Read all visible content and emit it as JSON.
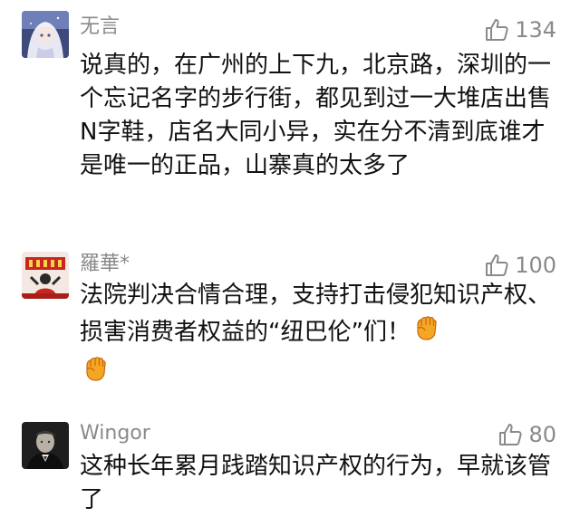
{
  "comments": [
    {
      "user": "无言",
      "likes": "134",
      "text": "说真的，在广州的上下九，北京路，深圳的一个忘记名字的步行街，都见到过一大堆店出售N字鞋，店名大同小异，实在分不清到底谁才是唯一的正品，山寨真的太多了",
      "avatar": "anime-girl-avatar"
    },
    {
      "user": "羅華*",
      "likes": "100",
      "text": "法院判决合情合理，支持打击侵犯知识产权、损害消费者权益的“纽巴伦”们！",
      "avatar": "red-banner-avatar",
      "emoji": "raised-fist-emoji"
    },
    {
      "user": "Wingor",
      "likes": "80",
      "text": "这种长年累月践踏知识产权的行为，早就该管了",
      "avatar": "godfather-avatar"
    }
  ],
  "colors": {
    "meta_gray": "#8a8a8a",
    "text": "#111111",
    "fist": "#f5a623"
  }
}
